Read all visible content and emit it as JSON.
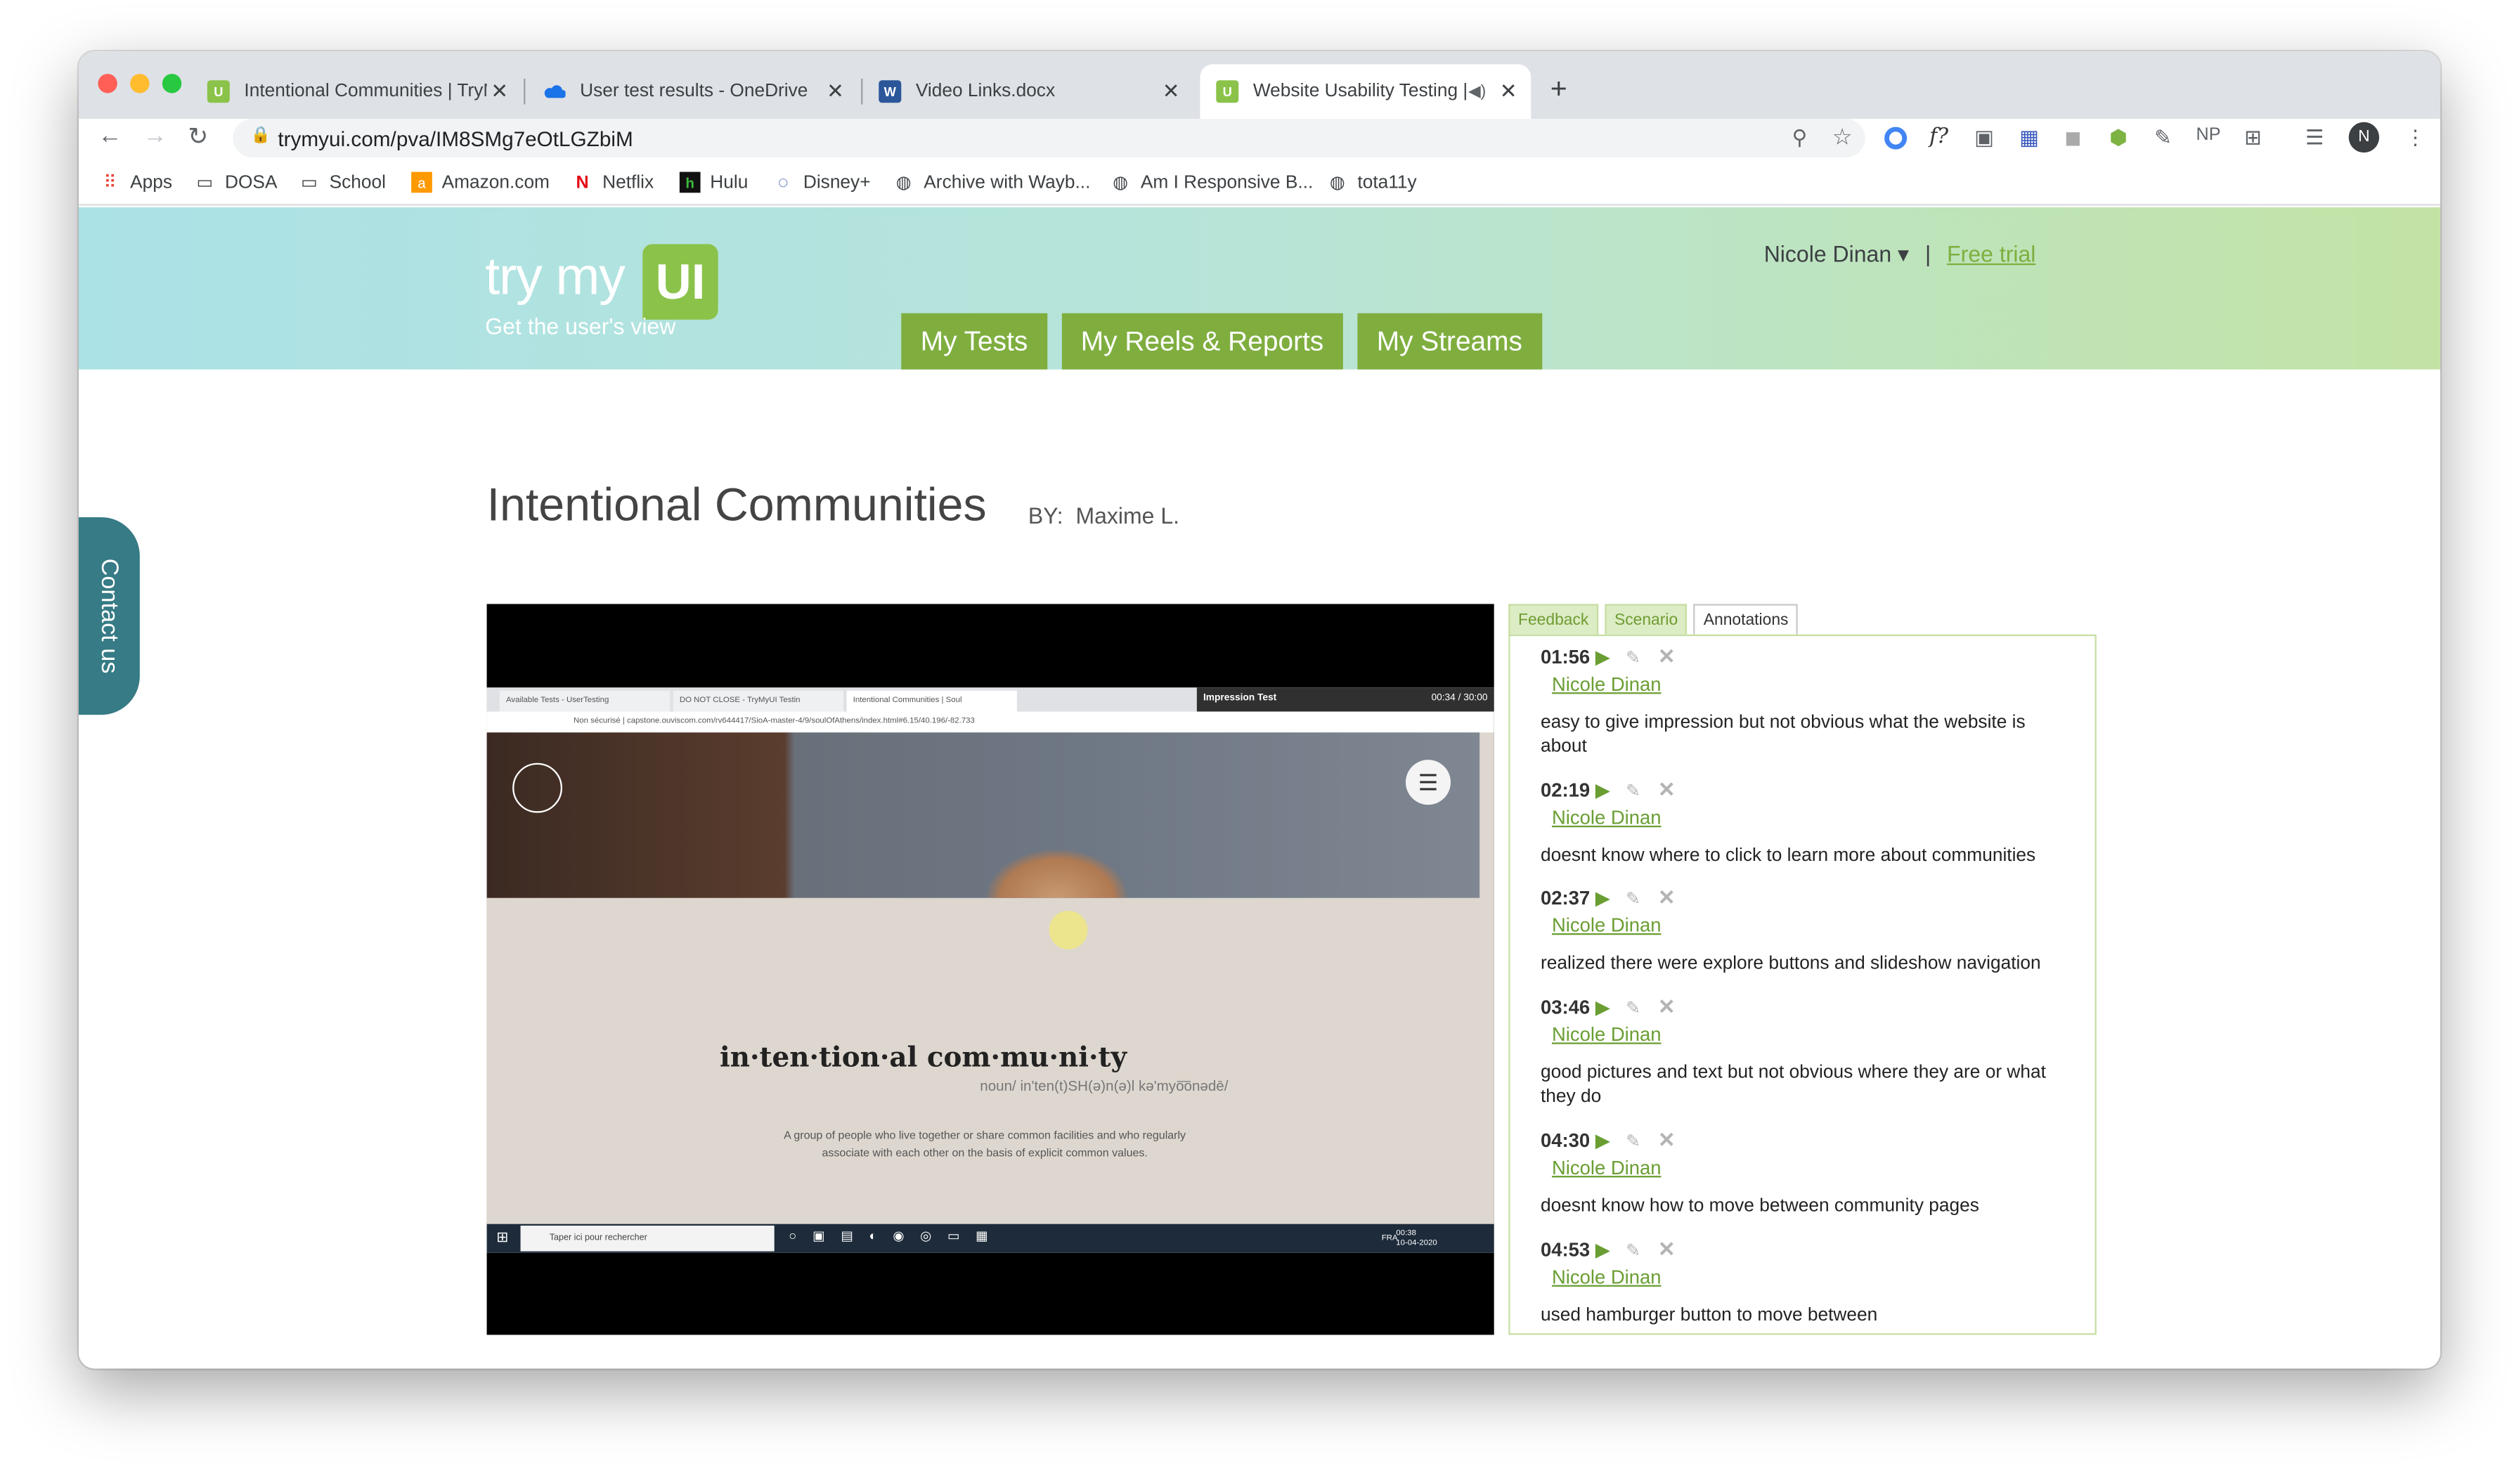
{
  "browser": {
    "tabs": [
      {
        "title": "Intentional Communities | TryM",
        "icon": "trymyui-icon",
        "active": false
      },
      {
        "title": "User test results - OneDrive",
        "icon": "onedrive-icon",
        "active": false
      },
      {
        "title": "Video Links.docx",
        "icon": "word-icon",
        "active": false
      },
      {
        "title": "Website Usability Testing |",
        "icon": "trymyui-icon",
        "active": true
      }
    ],
    "new_tab": "+",
    "url": "trymyui.com/pva/IM8SMg7eOtLGZbiM",
    "profile_initial": "N",
    "toolbar_ext": [
      "f?",
      "NP"
    ],
    "bookmarks": [
      {
        "label": "Apps",
        "icon": "apps-grid-icon"
      },
      {
        "label": "DOSA",
        "icon": "folder-icon"
      },
      {
        "label": "School",
        "icon": "folder-icon"
      },
      {
        "label": "Amazon.com",
        "icon": "amazon-icon"
      },
      {
        "label": "Netflix",
        "icon": "netflix-icon"
      },
      {
        "label": "Hulu",
        "icon": "hulu-icon"
      },
      {
        "label": "Disney+",
        "icon": "disney-icon"
      },
      {
        "label": "Archive with Wayb...",
        "icon": "globe-icon"
      },
      {
        "label": "Am I Responsive B...",
        "icon": "globe-icon"
      },
      {
        "label": "tota11y",
        "icon": "globe-icon"
      }
    ]
  },
  "site": {
    "logo_text": "try my",
    "logo_badge": "UI",
    "tagline": "Get the user's view",
    "user_name": "Nicole Dinan ▾",
    "separator": "|",
    "free_trial": "Free trial",
    "nav": [
      "My Tests",
      "My Reels & Reports",
      "My Streams"
    ],
    "contact": "Contact us",
    "colors": {
      "nav_green": "#7fae3f",
      "teal": "#367b85"
    }
  },
  "session": {
    "title": "Intentional Communities",
    "by_label": "BY:",
    "by_name": "Maxime L."
  },
  "video": {
    "impression_label": "Impression Test",
    "timer": "00:34 / 30:00",
    "address": "Non sécurisé  |  capstone.ouviscom.com/rv644417/SioA-master-4/9/soulOfAthens/index.html#6.15/40.196/-82.733",
    "tab_labels": [
      "Available Tests - UserTesting",
      "DO NOT CLOSE - TryMyUI Testin",
      "Intentional Communities | Soul"
    ],
    "def_word": "in·ten·tion·al com·mu·ni·ty",
    "pronunciation": "noun/ in'ten(t)SH(ə)n(ə)l kə'myo͞onədē/",
    "definition": "A group of people who live together or share common facilities and who regularly associate with each other on the basis of explicit common values.",
    "search_placeholder": "Taper ici pour rechercher",
    "lang": "FRA",
    "clock_time": "00:38",
    "clock_date": "10-04-2020"
  },
  "panel": {
    "tabs": [
      "Feedback",
      "Scenario",
      "Annotations"
    ],
    "active_tab": "Annotations",
    "annotations": [
      {
        "time": "01:56",
        "author": "Nicole Dinan",
        "comment": "easy to give impression but not obvious what the website is about"
      },
      {
        "time": "02:19",
        "author": "Nicole Dinan",
        "comment": "doesnt know where to click to learn more about communities"
      },
      {
        "time": "02:37",
        "author": "Nicole Dinan",
        "comment": "realized there were explore buttons and slideshow navigation"
      },
      {
        "time": "03:46",
        "author": "Nicole Dinan",
        "comment": "good pictures and text but not obvious where they are or what they do"
      },
      {
        "time": "04:30",
        "author": "Nicole Dinan",
        "comment": "doesnt know how to move between community pages"
      },
      {
        "time": "04:53",
        "author": "Nicole Dinan",
        "comment": "used hamburger button to move between"
      }
    ]
  }
}
